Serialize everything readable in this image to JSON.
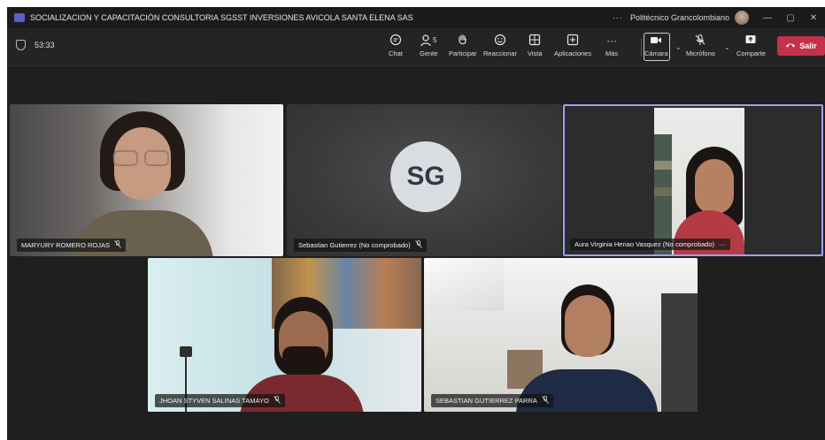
{
  "titlebar": {
    "title": "SOCIALIZACION Y CAPACITACIÓN CONSULTORIA SGSST INVERSIONES AVICOLA SANTA ELENA SAS",
    "more": "···",
    "org": "Politécnico Grancolombiano",
    "minimize": "—",
    "maximize": "▢",
    "close": "✕"
  },
  "toolbar": {
    "timer": "53:33",
    "chat": "Chat",
    "people": "Gente",
    "people_count": "5",
    "raise": "Participar",
    "react": "Reaccionar",
    "view": "Vista",
    "apps": "Aplicaciones",
    "more": "Más",
    "camera": "Cámara",
    "mic": "Micrófono",
    "share": "Comparte",
    "leave": "Salir"
  },
  "participants": [
    {
      "name": "MARYURY ROMERO ROJAS"
    },
    {
      "name": "Sebastian Gutierrez (No comprobado)",
      "initials": "SG"
    },
    {
      "name": "Aura Virginia Henao Vasquez (No comprobado)",
      "more": "···"
    },
    {
      "name": "JHOAN STYVEN SALINAS TAMAYO"
    },
    {
      "name": "SEBASTIAN GUTIERREZ PARRA"
    }
  ],
  "icons": {
    "mic_off": "🎙"
  },
  "colors": {
    "leave": "#c4314b",
    "accent": "#5b5fc7",
    "active_speaker_border": "#9da1f0"
  }
}
